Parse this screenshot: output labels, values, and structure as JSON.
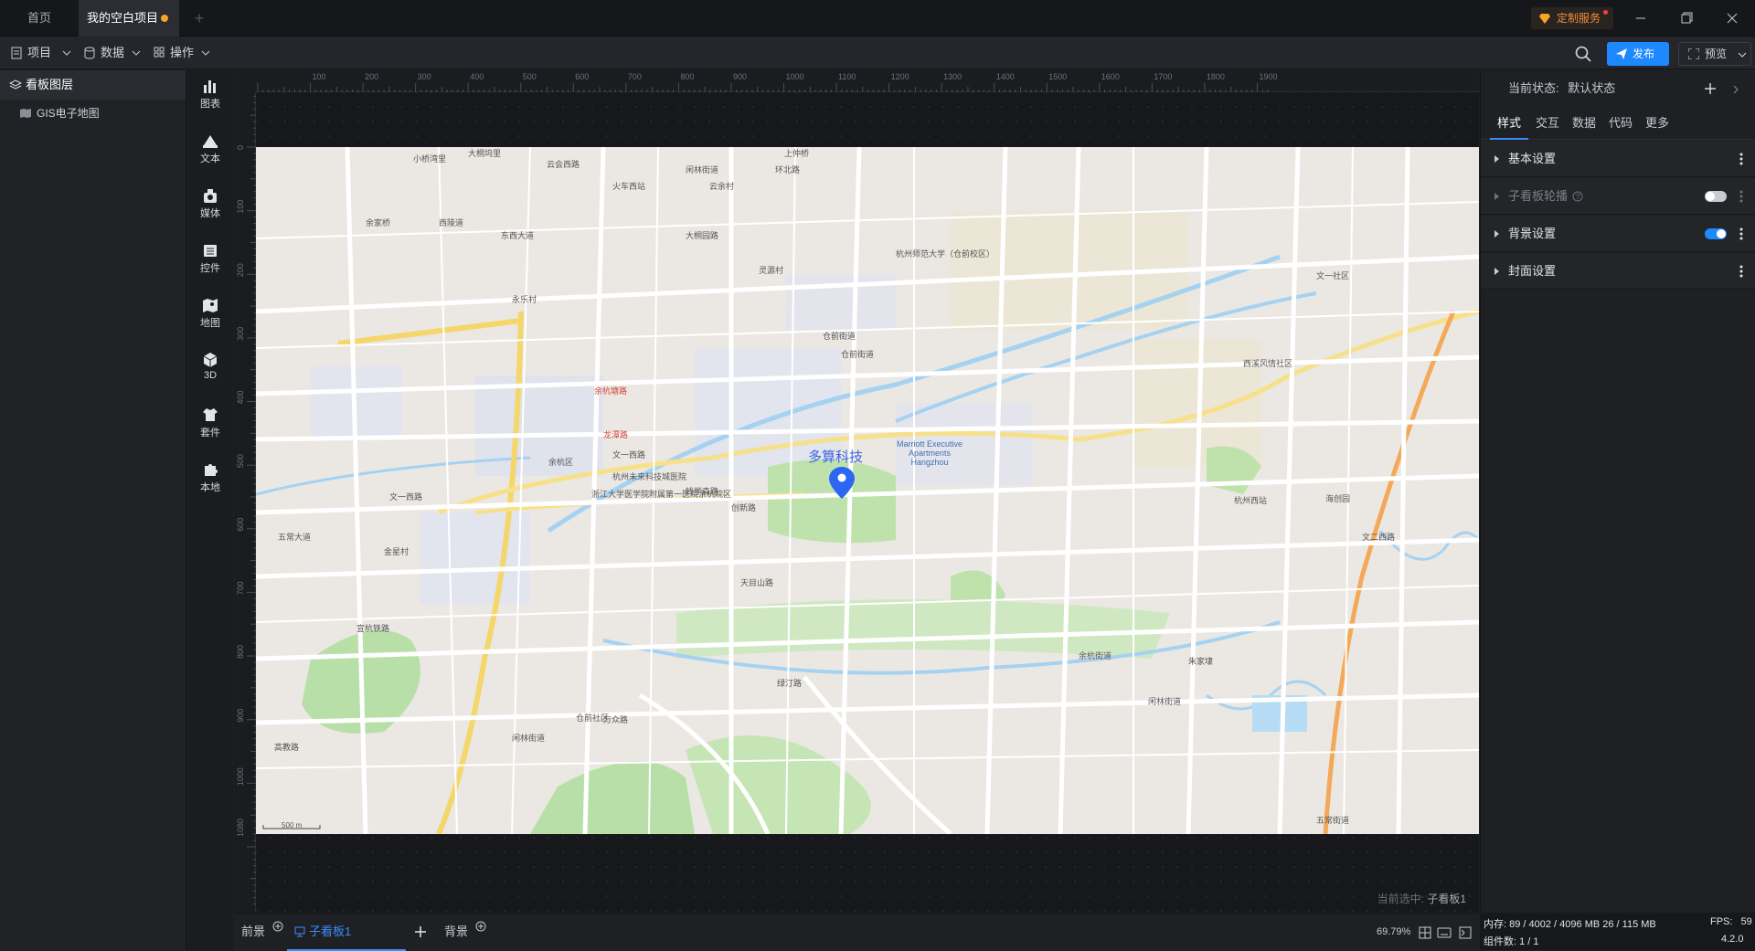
{
  "title_tabs": {
    "home": "首页",
    "project": "我的空白项目"
  },
  "title_actions": {
    "custom_service": "定制服务"
  },
  "toolbar": {
    "project": "项目",
    "data": "数据",
    "operate": "操作",
    "publish": "发布",
    "preview": "预览"
  },
  "layers": {
    "header": "看板图层",
    "items": [
      {
        "label": "GIS电子地图"
      }
    ]
  },
  "components": [
    "图表",
    "文本",
    "媒体",
    "控件",
    "地图",
    "3D",
    "套件",
    "本地"
  ],
  "ruler": {
    "top": [
      "100",
      "200",
      "300",
      "400",
      "500",
      "600",
      "700",
      "800",
      "900",
      "1000",
      "1100",
      "1200",
      "1300",
      "1400",
      "1500",
      "1600",
      "1700",
      "1800",
      "1900"
    ],
    "left": [
      "0",
      "100",
      "200",
      "300",
      "400",
      "500",
      "600",
      "700",
      "800",
      "900",
      "1000",
      "1080"
    ]
  },
  "map": {
    "marker_label": "多算科技",
    "labels": [
      "大桐坞里",
      "小桥湾里",
      "云会西路",
      "上仲桥",
      "环北路",
      "闲林街道",
      "云余村",
      "火车西站",
      "大桐园路",
      "余家桥",
      "西陵道",
      "东西大道",
      "灵源村",
      "仓前街道",
      "杭州师范大学（仓前校区）",
      "文一社区",
      "永乐村",
      "仓前街道",
      "西溪风情社区",
      "余杭塘路",
      "龙潭路",
      "文一西路",
      "余杭区",
      "杭州未来科技城医院",
      "浙江大学医学院附属第一医院余杭院区",
      "钱学森路",
      "创新路",
      "文一西路",
      "金星村",
      "五常大道",
      "天目山路",
      "绿汀路",
      "仓前社区",
      "万众路",
      "闲林街道",
      "高教路",
      "宣杭铁路",
      "余杭街道",
      "闲林街道",
      "杭州西站",
      "海创园",
      "文二西路",
      "朱家埭",
      "五常街道"
    ],
    "poi_labels": [
      "Marriott Executive Apartments Hangzhou"
    ],
    "scale_text": "500 m"
  },
  "current_selected": {
    "prefix": "当前选中:",
    "value": "子看板1"
  },
  "bottom_tabs": {
    "front": "前景",
    "sub": "子看板1",
    "back": "背景",
    "zoom": "69.79%"
  },
  "right_panel": {
    "state_label": "当前状态:",
    "state_value": "默认状态",
    "tabs": [
      "样式",
      "交互",
      "数据",
      "代码",
      "更多"
    ],
    "sections": [
      "基本设置",
      "子看板轮播",
      "背景设置",
      "封面设置"
    ]
  },
  "status": {
    "memory_label": "内存:",
    "memory_value": "89 / 4002 / 4096 MB  26 / 115 MB",
    "fps_label": "FPS:",
    "fps_value": "59",
    "component_label": "组件数:",
    "component_value": "1 / 1",
    "version": "4.2.0"
  },
  "colors": {
    "accent": "#1e88ff",
    "orange": "#f5a623",
    "custom_service": "#f08a3c"
  }
}
